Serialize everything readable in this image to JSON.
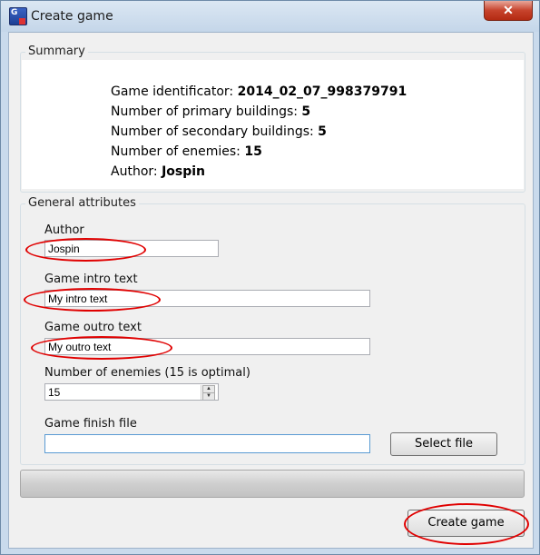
{
  "window": {
    "title": "Create game",
    "close_glyph": "✕"
  },
  "summary": {
    "group_title": "Summary",
    "lines": [
      {
        "label": "Game identificator: ",
        "value": "2014_02_07_998379791"
      },
      {
        "label": "Number of primary buildings: ",
        "value": "5"
      },
      {
        "label": "Number of secondary buildings: ",
        "value": "5"
      },
      {
        "label": "Number of enemies: ",
        "value": "15"
      },
      {
        "label": "Author: ",
        "value": "Jospin"
      }
    ]
  },
  "general": {
    "group_title": "General attributes",
    "author_label": "Author",
    "author_value": "Jospin",
    "intro_label": "Game intro text",
    "intro_value": "My intro text",
    "outro_label": "Game outro text",
    "outro_value": "My outro text",
    "enemies_label": "Number of enemies (15 is optimal)",
    "enemies_value": "15",
    "finish_label": "Game finish file",
    "finish_value": "",
    "select_file_label": "Select file"
  },
  "progress": {
    "value": 0
  },
  "actions": {
    "create_label": "Create game"
  },
  "colors": {
    "annotation": "#e00000"
  }
}
